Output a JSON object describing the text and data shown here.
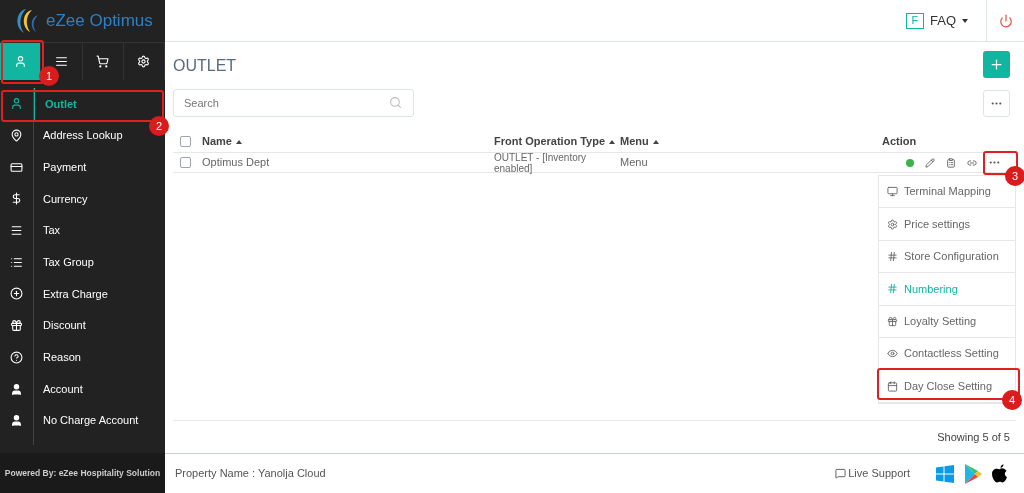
{
  "brand": {
    "name": "eZee Optimus"
  },
  "sidebar": {
    "tabs": [
      {
        "selected": true
      },
      {
        "selected": false
      },
      {
        "selected": false
      },
      {
        "selected": false
      }
    ],
    "items": [
      {
        "label": "Outlet",
        "selected": true
      },
      {
        "label": "Address Lookup",
        "selected": false
      },
      {
        "label": "Payment",
        "selected": false
      },
      {
        "label": "Currency",
        "selected": false
      },
      {
        "label": "Tax",
        "selected": false
      },
      {
        "label": "Tax Group",
        "selected": false
      },
      {
        "label": "Extra Charge",
        "selected": false
      },
      {
        "label": "Discount",
        "selected": false
      },
      {
        "label": "Reason",
        "selected": false
      },
      {
        "label": "Account",
        "selected": false
      },
      {
        "label": "No Charge Account",
        "selected": false
      }
    ],
    "footer": "Powered By: eZee Hospitality Solution"
  },
  "header": {
    "faq_badge": "F",
    "faq": "FAQ"
  },
  "page": {
    "title": "OUTLET",
    "search": {
      "placeholder": "Search"
    }
  },
  "table": {
    "columns": [
      "Name",
      "Front Operation Type",
      "Menu",
      "Action"
    ],
    "header_checked": false,
    "rows": [
      {
        "name": "Optimus Dept",
        "type": "OUTLET - [Inventory enabled]",
        "menu": "Menu",
        "checked": false,
        "active": true
      }
    ],
    "showing": "Showing 5 of 5"
  },
  "action_menu": [
    {
      "label": "Terminal Mapping",
      "selected": false
    },
    {
      "label": "Price settings",
      "selected": false
    },
    {
      "label": "Store Configuration",
      "selected": false
    },
    {
      "label": "Numbering",
      "selected": true
    },
    {
      "label": "Loyalty Setting",
      "selected": false
    },
    {
      "label": "Contactless Setting",
      "selected": false
    },
    {
      "label": "Day Close Setting",
      "selected": false
    }
  ],
  "footer": {
    "property": "Property Name : Yanolja Cloud",
    "live_support": "Live Support"
  },
  "callouts": [
    "1",
    "2",
    "3",
    "4"
  ]
}
